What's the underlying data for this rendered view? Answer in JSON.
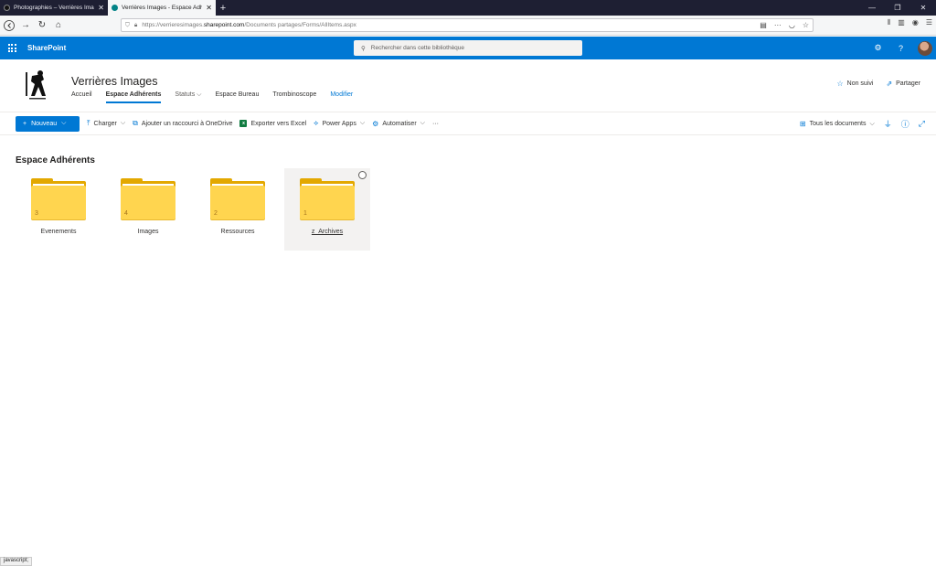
{
  "browser": {
    "tabs": [
      {
        "title": "Photographies – Verrières Imag",
        "active": false
      },
      {
        "title": "Verrières Images - Espace Adhé",
        "active": true
      }
    ],
    "url_prefix": "https://verrieresimages.",
    "url_host": "sharepoint.com",
    "url_path": "/Documents partages/Forms/AllItems.aspx"
  },
  "suite": {
    "brand": "SharePoint",
    "search_placeholder": "Rechercher dans cette bibliothèque",
    "color": "#0078d4"
  },
  "site": {
    "title": "Verrières Images",
    "nav": [
      {
        "label": "Accueil"
      },
      {
        "label": "Espace Adhérents"
      },
      {
        "label": "Statuts"
      },
      {
        "label": "Espace Bureau"
      },
      {
        "label": "Trombinoscope"
      },
      {
        "label": "Modifier"
      }
    ],
    "follow_label": "Non suivi",
    "share_label": "Partager"
  },
  "commands": {
    "new_label": "Nouveau",
    "upload_label": "Charger",
    "shortcut_label": "Ajouter un raccourci à OneDrive",
    "export_label": "Exporter vers Excel",
    "powerapps_label": "Power Apps",
    "automate_label": "Automatiser",
    "more_label": "···",
    "view_label": "Tous les documents"
  },
  "library": {
    "title": "Espace Adhérents",
    "folders": [
      {
        "name": "Evenements",
        "count": "3"
      },
      {
        "name": "Images",
        "count": "4"
      },
      {
        "name": "Ressources",
        "count": "2"
      },
      {
        "name": "z_Archives",
        "count": "1",
        "selected": true
      }
    ]
  },
  "status_text": "javascript;"
}
